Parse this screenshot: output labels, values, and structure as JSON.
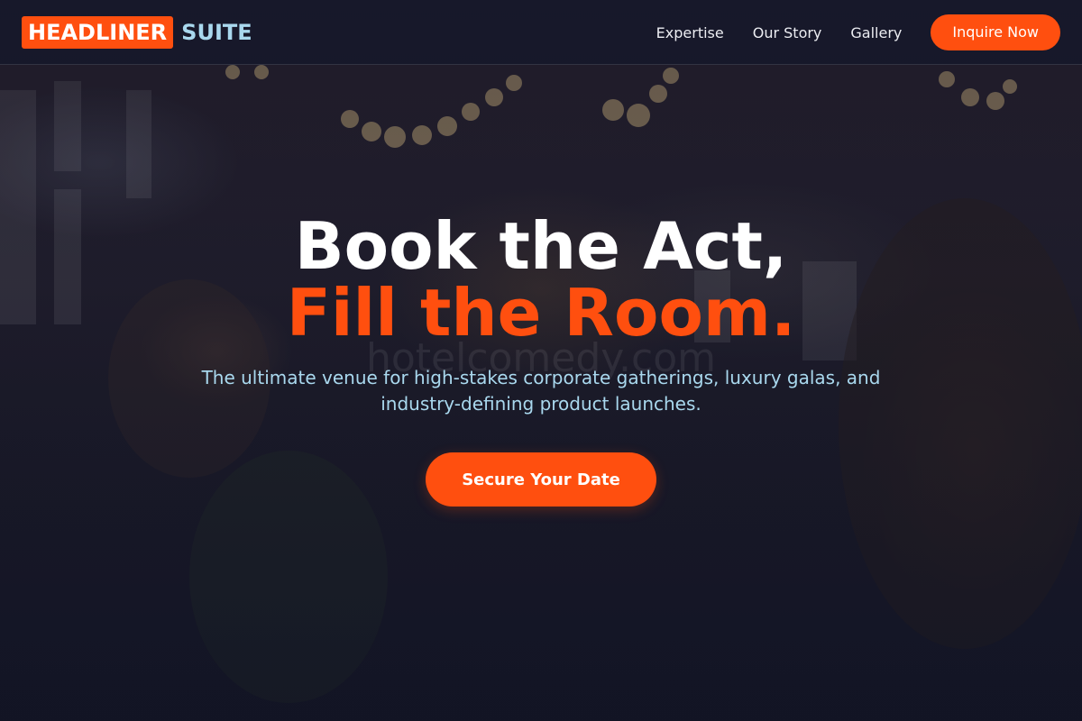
{
  "brand": {
    "logo_primary": "HEADLINER",
    "logo_secondary": "SUITE",
    "accent_color": "#ff4f0f",
    "secondary_color": "#a9d8ee"
  },
  "nav": {
    "links": [
      "Expertise",
      "Our Story",
      "Gallery"
    ],
    "cta_label": "Inquire Now"
  },
  "hero": {
    "headline_line1": "Book the Act,",
    "headline_line2": "Fill the Room.",
    "subtext": "The ultimate venue for high-stakes corporate gatherings, luxury galas, and industry-defining product launches.",
    "cta_label": "Secure Your Date",
    "watermark": "hotelcomedy.com",
    "background_image": "blurred banquet crowd raising champagne glasses under string lights"
  }
}
